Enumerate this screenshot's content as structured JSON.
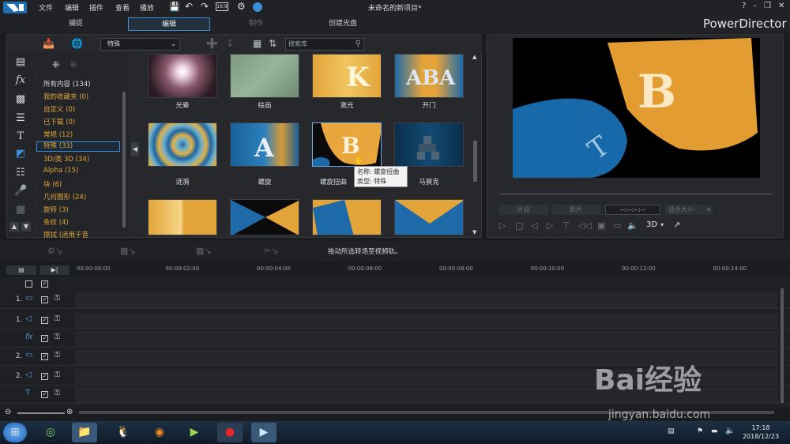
{
  "app": {
    "brand": "PowerDirector",
    "title": "未命名的新项目*",
    "menu": [
      "文件",
      "编辑",
      "插件",
      "查看",
      "播放"
    ]
  },
  "modes": [
    {
      "label": "捕捉"
    },
    {
      "label": "编辑"
    },
    {
      "label": "制作"
    },
    {
      "label": "创建光盘"
    }
  ],
  "library": {
    "filter_value": "特殊",
    "search_placeholder": "搜索库",
    "categories": [
      {
        "label": "所有内容 (134)",
        "color": "#d8dbde"
      },
      {
        "label": "我的收藏夹 (0)",
        "color": "#e0a63a"
      },
      {
        "label": "自定义 (0)",
        "color": "#e0a63a"
      },
      {
        "label": "已下载 (0)",
        "color": "#e0a63a"
      },
      {
        "label": "常规 (12)",
        "color": "#e0a63a"
      },
      {
        "label": "特殊 (33)",
        "color": "#e0a63a"
      },
      {
        "label": "3D/类 3D (34)",
        "color": "#e0a63a"
      },
      {
        "label": "Alpha (15)",
        "color": "#e0a63a"
      },
      {
        "label": "块 (6)",
        "color": "#e0a63a"
      },
      {
        "label": "几何图形 (24)",
        "color": "#e0a63a"
      },
      {
        "label": "旋转 (3)",
        "color": "#e0a63a"
      },
      {
        "label": "条纹 (4)",
        "color": "#e0a63a"
      },
      {
        "label": "擦拭 (适用于音",
        "color": "#e0a63a"
      }
    ],
    "transitions": [
      {
        "name": "光晕"
      },
      {
        "name": "绘画"
      },
      {
        "name": "激光"
      },
      {
        "name": "开门"
      },
      {
        "name": "涟漪"
      },
      {
        "name": "螺旋"
      },
      {
        "name": "螺旋扭曲"
      },
      {
        "name": "马赛克"
      },
      {
        "name": ""
      },
      {
        "name": ""
      },
      {
        "name": ""
      },
      {
        "name": ""
      }
    ],
    "tooltip": {
      "name": "名称: 螺旋扭曲",
      "type": "类型: 特殊"
    }
  },
  "preview": {
    "btn_left": "片段",
    "btn_right": "影片",
    "timecode": "--:--:--:--",
    "size_label": "适合大小",
    "mode_3d": "3D"
  },
  "timeline": {
    "hint": "拖动所选转场至视频轨。",
    "ruler": [
      "00:00:00:00",
      "00:00:02:00",
      "00:00:04:00",
      "00:00:06:00",
      "00:00:08:00",
      "00:00:10:00",
      "00:00:12:00",
      "00:00:14:00"
    ],
    "tracks": [
      {
        "label": "1.",
        "icon": "video-track-icon"
      },
      {
        "label": "1.",
        "icon": "audio-track-icon"
      },
      {
        "label": "",
        "icon": "fx-track-icon"
      },
      {
        "label": "2.",
        "icon": "video-track-icon"
      },
      {
        "label": "2.",
        "icon": "audio-track-icon"
      },
      {
        "label": "",
        "icon": "title-track-icon"
      }
    ]
  },
  "taskbar": {
    "time": "17:18",
    "date": "2018/12/23"
  },
  "watermark": {
    "text": "Bai经验",
    "url": "jingyan.baidu.com"
  },
  "colors": {
    "accent": "#3b8fd6",
    "category_text": "#e0a63a"
  }
}
